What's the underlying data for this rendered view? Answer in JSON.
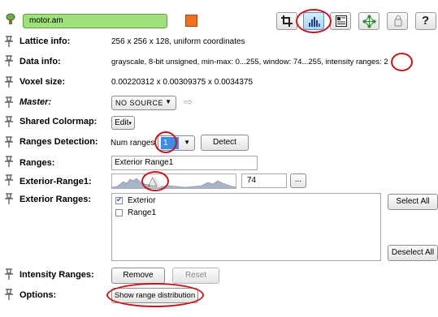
{
  "module": {
    "name": "motor.am",
    "color": "#f07020",
    "name_bg": "#9ee07a"
  },
  "toolbar": {
    "icons": [
      "crop-icon",
      "histogram-icon",
      "document-icon",
      "network-icon",
      "lock-icon",
      "help-icon"
    ],
    "help_label": "?"
  },
  "rows": {
    "lattice": {
      "label": "Lattice info:",
      "value": "256 x 256 x 128, uniform coordinates"
    },
    "data": {
      "label": "Data info:",
      "value": "grayscale, 8-bit unsigned, min-max: 0...255, window: 74...255, intensity ranges: 2"
    },
    "voxel": {
      "label": "Voxel size:",
      "value": "0.00220312 x 0.00309375 x 0.0034375"
    },
    "master": {
      "label": "Master:",
      "value": "NO SOURCE"
    },
    "colormap": {
      "label": "Shared Colormap:",
      "button": "Edit"
    },
    "detection": {
      "label": "Ranges Detection:",
      "num_label": "Num ranges",
      "num_value": "1",
      "detect": "Detect"
    },
    "ranges": {
      "label": "Ranges:",
      "value": "Exterior Range1"
    },
    "ext_range1": {
      "label": "Exterior-Range1:",
      "value": "74",
      "browse": "..."
    },
    "ext_ranges": {
      "label": "Exterior Ranges:",
      "items": [
        {
          "label": "Exterior",
          "checked": true
        },
        {
          "label": "Range1",
          "checked": false
        }
      ],
      "select_all": "Select All",
      "deselect_all": "Deselect All"
    },
    "intensity": {
      "label": "Intensity Ranges:",
      "remove": "Remove",
      "reset": "Reset"
    },
    "options": {
      "label": "Options:",
      "button": "Show range distribution"
    }
  },
  "colors": {
    "annotation": "#c8171c",
    "histogram": "#a8b4c8"
  }
}
